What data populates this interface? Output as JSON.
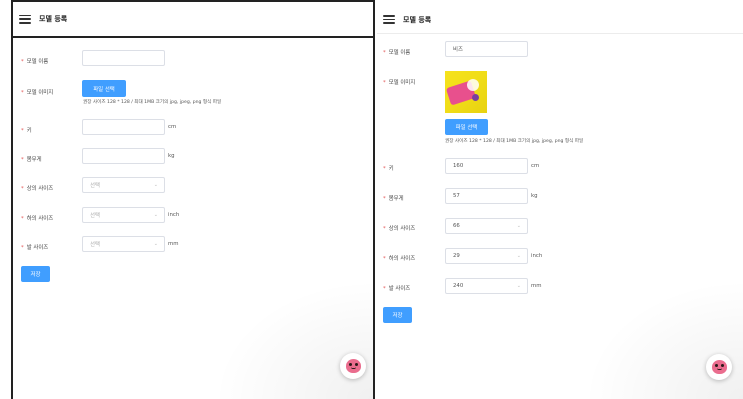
{
  "left": {
    "title": "모델 등록",
    "labels": {
      "name": "모델 이름",
      "image": "모델 이미지",
      "height": "키",
      "weight": "몸무게",
      "top": "상의 사이즈",
      "bottom": "하의 사이즈",
      "shoe": "발 사이즈"
    },
    "values": {
      "name": "",
      "height": "",
      "weight": ""
    },
    "select_placeholder": "선택",
    "file_button": "파일 선택",
    "hint": "권장 사이즈 128 * 128 / 최대 1MB 크기의 jpg, jpeg, png 형식 파일",
    "units": {
      "height": "cm",
      "weight": "kg",
      "bottom": "inch",
      "shoe": "mm"
    },
    "save_button": "저장"
  },
  "right": {
    "title": "모델 등록",
    "labels": {
      "name": "모델 이름",
      "image": "모델 이미지",
      "height": "키",
      "weight": "몸무게",
      "top": "상의 사이즈",
      "bottom": "하의 사이즈",
      "shoe": "발 사이즈"
    },
    "values": {
      "name": "비즈",
      "height": "160",
      "weight": "57",
      "top": "66",
      "bottom": "29",
      "shoe": "240"
    },
    "file_button": "파일 선택",
    "hint": "권장 사이즈 128 * 128 / 최대 1MB 크기의 jpg, jpeg, png 형식 파일",
    "units": {
      "height": "cm",
      "weight": "kg",
      "bottom": "inch",
      "shoe": "mm"
    },
    "save_button": "저장"
  },
  "required_mark": "*",
  "chevron": "⌄",
  "colors": {
    "primary": "#409eff",
    "required": "#e25555"
  }
}
